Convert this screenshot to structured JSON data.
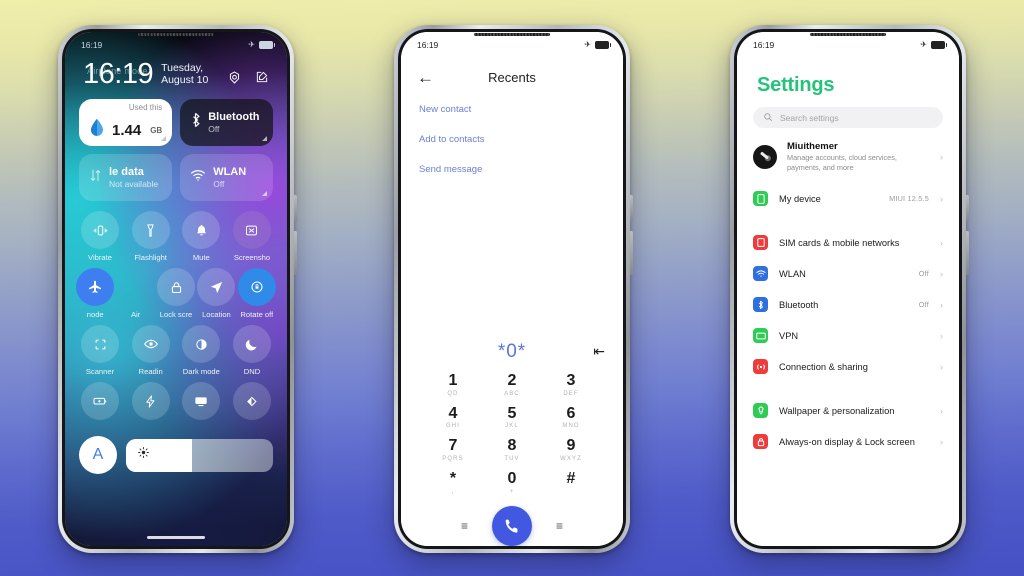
{
  "background": {
    "top_color": "#efeeab",
    "bottom_color": "#4551c4"
  },
  "phone1": {
    "statusbar": {
      "time": "16:19",
      "airplane_icon": "airplane-icon",
      "battery_icon": "battery-icon"
    },
    "airplane_note": "Airplane mode",
    "clock": {
      "time": "16:19",
      "date": "Tuesday, August 10"
    },
    "header_actions": [
      {
        "name": "settings-gear-icon",
        "label": "Settings"
      },
      {
        "name": "edit-icon",
        "label": "Edit"
      }
    ],
    "cards": [
      {
        "name": "data-usage-card",
        "caption": "Used this",
        "amount": "1.44",
        "unit": "GB",
        "style": "light"
      },
      {
        "name": "mobile-data-card",
        "title": "le data",
        "subtitle": "Not available",
        "icon": "mobile-data-icon",
        "style": "glass"
      },
      {
        "name": "bluetooth-card",
        "title": "Bluetooth",
        "subtitle": "Off",
        "icon": "bluetooth-icon",
        "style": "dark"
      },
      {
        "name": "wlan-card",
        "title": "WLAN",
        "subtitle": "Off",
        "icon": "wifi-icon",
        "style": "glass"
      }
    ],
    "toggle_rows": [
      [
        {
          "label": "Vibrate",
          "icon": "vibrate-icon",
          "state": "off"
        },
        {
          "label": "Flashlight",
          "icon": "flashlight-icon",
          "state": "off"
        },
        {
          "label": "Mute",
          "icon": "bell-icon",
          "state": "off"
        },
        {
          "label": "Screensho",
          "icon": "screenshot-icon",
          "state": "violet"
        }
      ],
      [
        {
          "label": "node",
          "icon": "airplane-icon",
          "state": "on"
        },
        {
          "label": "Air",
          "icon": "lock-icon",
          "state": "off"
        },
        {
          "label": "Lock scre",
          "icon": "lock-icon",
          "state": "off"
        },
        {
          "label": "Location",
          "icon": "location-icon",
          "state": "off"
        },
        {
          "label": "Rotate off",
          "icon": "rotate-lock-icon",
          "state": "on2"
        }
      ],
      [
        {
          "label": "Scanner",
          "icon": "scanner-icon",
          "state": "off"
        },
        {
          "label": "Readin",
          "icon": "eye-icon",
          "state": "off"
        },
        {
          "label": "Dark mode",
          "icon": "contrast-icon",
          "state": "off"
        },
        {
          "label": "DND",
          "icon": "moon-icon",
          "state": "off"
        }
      ],
      [
        {
          "label": "",
          "icon": "battery-saver-icon",
          "state": "off"
        },
        {
          "label": "",
          "icon": "lightning-icon",
          "state": "off"
        },
        {
          "label": "",
          "icon": "cast-icon",
          "state": "off"
        },
        {
          "label": "",
          "icon": "reading-contrast-icon",
          "state": "off"
        }
      ]
    ],
    "brightness": {
      "auto_label": "A",
      "icon": "sun-icon",
      "fill_percent": 45
    }
  },
  "phone2": {
    "statusbar": {
      "time": "16:19"
    },
    "title": "Recents",
    "back_icon": "back-arrow-icon",
    "links": [
      "New contact",
      "Add to contacts",
      "Send message"
    ],
    "dialed_number": "*0*",
    "backspace_icon": "backspace-icon",
    "keys": [
      {
        "digit": "1",
        "letters": "QD"
      },
      {
        "digit": "2",
        "letters": "ABC"
      },
      {
        "digit": "3",
        "letters": "DEF"
      },
      {
        "digit": "4",
        "letters": "GHI"
      },
      {
        "digit": "5",
        "letters": "JKL"
      },
      {
        "digit": "6",
        "letters": "MNO"
      },
      {
        "digit": "7",
        "letters": "PQRS"
      },
      {
        "digit": "8",
        "letters": "TUV"
      },
      {
        "digit": "9",
        "letters": "WXYZ"
      },
      {
        "digit": "*",
        "letters": ","
      },
      {
        "digit": "0",
        "letters": "+"
      },
      {
        "digit": "#",
        "letters": ""
      }
    ],
    "left_menu_icon": "menu-icon",
    "right_menu_icon": "menu-icon",
    "call_icon": "phone-call-icon",
    "accent_color": "#4258e0"
  },
  "phone3": {
    "statusbar": {
      "time": "16:19"
    },
    "title": "Settings",
    "title_color": "#23c37a",
    "search": {
      "placeholder": "Search settings",
      "icon": "search-icon"
    },
    "account": {
      "name": "Miuithemer",
      "subtitle": "Manage accounts, cloud services, payments, and more",
      "avatar": "avatar"
    },
    "groups": [
      {
        "items": [
          {
            "label": "My device",
            "value": "MIUI 12.5.5",
            "icon": "device-icon",
            "color": "#2ecc55"
          }
        ]
      },
      {
        "items": [
          {
            "label": "SIM cards & mobile networks",
            "value": "",
            "icon": "sim-icon",
            "color": "#ee3b3b"
          },
          {
            "label": "WLAN",
            "value": "Off",
            "icon": "wifi-icon",
            "color": "#2f6fe0"
          },
          {
            "label": "Bluetooth",
            "value": "Off",
            "icon": "bluetooth-icon",
            "color": "#2f6fe0"
          },
          {
            "label": "VPN",
            "value": "",
            "icon": "vpn-icon",
            "color": "#2ecc55"
          },
          {
            "label": "Connection & sharing",
            "value": "",
            "icon": "connection-icon",
            "color": "#ee3b3b"
          }
        ]
      },
      {
        "items": [
          {
            "label": "Wallpaper & personalization",
            "value": "",
            "icon": "wallpaper-icon",
            "color": "#2ecc55"
          },
          {
            "label": "Always-on display & Lock screen",
            "value": "",
            "icon": "lock-icon",
            "color": "#ee3b3b"
          }
        ]
      }
    ],
    "chevron": "›"
  }
}
